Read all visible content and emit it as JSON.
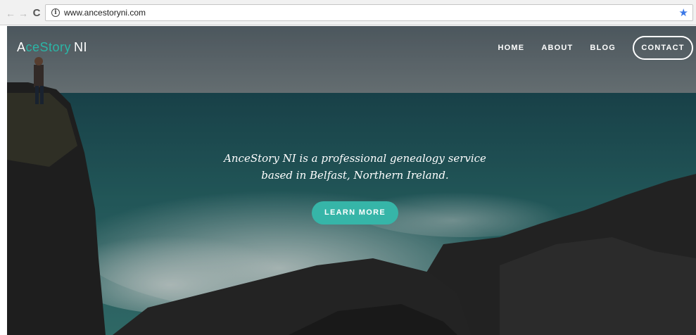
{
  "browser": {
    "url": "www.ancestoryni.com",
    "back_glyph": "←",
    "forward_glyph": "→",
    "reload_glyph": "C",
    "info_glyph": "i",
    "star_glyph": "★"
  },
  "site": {
    "logo": {
      "part1": "A",
      "part2": "ceStory",
      "part3": "NI"
    },
    "nav": {
      "home": "HOME",
      "about": "ABOUT",
      "blog": "BLOG",
      "contact": "CONTACT"
    },
    "hero": {
      "tagline_line1": "AnceStory NI is a professional genealogy service",
      "tagline_line2": "based in Belfast, Northern Ireland.",
      "cta": "LEARN MORE"
    }
  },
  "colors": {
    "accent": "#36b5a8",
    "logo_accent": "#2bb5a6",
    "sea": "#1f5b5f",
    "sky": "#6f7b82"
  }
}
